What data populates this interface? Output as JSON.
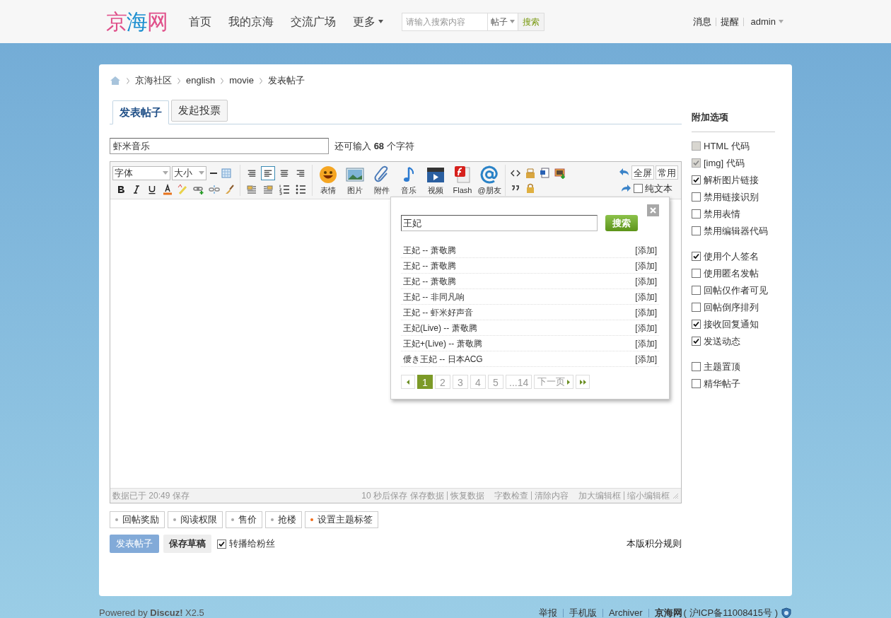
{
  "header": {
    "logo": "京海网",
    "nav": [
      "首页",
      "我的京海",
      "交流广场",
      "更多"
    ],
    "search": {
      "placeholder": "请输入搜索内容",
      "type": "帖子",
      "button": "搜索"
    },
    "user_links": [
      "消息",
      "提醒"
    ],
    "user": "admin"
  },
  "breadcrumb": [
    "京海社区",
    "english",
    "movie",
    "发表帖子"
  ],
  "tabs": [
    {
      "label": "发表帖子",
      "selected": true
    },
    {
      "label": "发起投票",
      "selected": false
    }
  ],
  "title_field": {
    "value": "虾米音乐",
    "counter": "还可输入 **68** 个字符"
  },
  "toolbar": {
    "font": "字体",
    "size": "大小",
    "align": [
      {
        "selected": false
      },
      {
        "selected": true
      },
      {
        "selected": false
      },
      {
        "selected": false
      }
    ],
    "media": [
      {
        "kind": "emoji",
        "label": "表情"
      },
      {
        "kind": "image",
        "label": "图片"
      },
      {
        "kind": "attach",
        "label": "附件"
      },
      {
        "kind": "music",
        "label": "音乐"
      },
      {
        "kind": "video",
        "label": "视频"
      },
      {
        "kind": "flash",
        "label": "Flash"
      },
      {
        "kind": "at",
        "label": "@朋友"
      }
    ],
    "fullscreen": "全屏",
    "common": "常用",
    "plain_text": {
      "label": "纯文本",
      "checked": false
    }
  },
  "music_popup": {
    "query": "王妃",
    "button": "搜索",
    "results": [
      {
        "title": "王妃 -- 萧敬腾",
        "action": "[添加]"
      },
      {
        "title": "王妃 -- 萧敬腾",
        "action": "[添加]"
      },
      {
        "title": "王妃 -- 萧敬腾",
        "action": "[添加]"
      },
      {
        "title": "王妃 -- 非同凡响",
        "action": "[添加]"
      },
      {
        "title": "王妃 -- 虾米好声音",
        "action": "[添加]"
      },
      {
        "title": "王妃(Live) -- 萧敬腾",
        "action": "[添加]"
      },
      {
        "title": "王妃+(Live) -- 萧敬腾",
        "action": "[添加]"
      },
      {
        "title": "僾き王妃 -- 日本ACG",
        "action": "[添加]"
      }
    ],
    "pages": [
      {
        "label": "1",
        "selected": true
      },
      {
        "label": "2",
        "selected": false
      },
      {
        "label": "3",
        "selected": false
      },
      {
        "label": "4",
        "selected": false
      },
      {
        "label": "5",
        "selected": false
      },
      {
        "label": "...14",
        "selected": false
      }
    ],
    "next": "下一页"
  },
  "status_bar": {
    "saved": "数据已于 20:49 保存",
    "autosave": "10 秒后保存",
    "links_1": [
      "保存数据",
      "恢复数据"
    ],
    "links_2": [
      "字数检查",
      "清除内容"
    ],
    "links_3": [
      "加大编辑框",
      "缩小编辑框"
    ]
  },
  "extras": [
    {
      "label": "回帖奖励",
      "color": "#aaaaaa"
    },
    {
      "label": "阅读权限",
      "color": "#aaaaaa"
    },
    {
      "label": "售价",
      "color": "#aaaaaa"
    },
    {
      "label": "抢楼",
      "color": "#aaaaaa"
    },
    {
      "label": "设置主题标签",
      "color": "#f26c1a"
    }
  ],
  "actions": {
    "submit": "发表帖子",
    "draft": "保存草稿",
    "repost": {
      "label": "转播给粉丝",
      "checked": true
    },
    "rules": "本版积分规则"
  },
  "sidebar": {
    "title": "附加选项",
    "groups": [
      [
        {
          "label": "HTML 代码",
          "checked": false,
          "disabled": true
        },
        {
          "label": "[img] 代码",
          "checked": true,
          "disabled": true
        },
        {
          "label": "解析图片链接",
          "checked": true,
          "disabled": false
        },
        {
          "label": "禁用链接识别",
          "checked": false,
          "disabled": false
        },
        {
          "label": "禁用表情",
          "checked": false,
          "disabled": false
        },
        {
          "label": "禁用编辑器代码",
          "checked": false,
          "disabled": false
        }
      ],
      [
        {
          "label": "使用个人签名",
          "checked": true,
          "disabled": false
        },
        {
          "label": "使用匿名发帖",
          "checked": false,
          "disabled": false
        },
        {
          "label": "回帖仅作者可见",
          "checked": false,
          "disabled": false
        },
        {
          "label": "回帖倒序排列",
          "checked": false,
          "disabled": false
        },
        {
          "label": "接收回复通知",
          "checked": true,
          "disabled": false
        },
        {
          "label": "发送动态",
          "checked": true,
          "disabled": false
        }
      ],
      [
        {
          "label": "主题置顶",
          "checked": false,
          "disabled": false
        },
        {
          "label": "精华帖子",
          "checked": false,
          "disabled": false
        }
      ]
    ]
  },
  "footer": {
    "powered": "Powered by **Discuz!** X2.5",
    "links": [
      "举报",
      "手机版",
      "Archiver"
    ],
    "site": "京海网",
    "icp": "( 沪ICP备11008415号 )"
  }
}
